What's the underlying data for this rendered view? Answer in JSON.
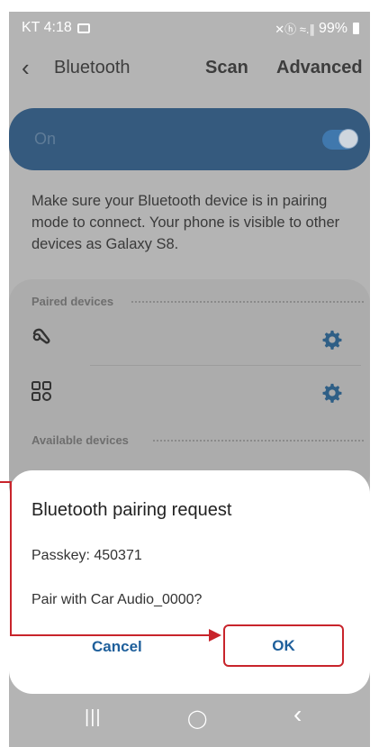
{
  "status_bar": {
    "carrier_time": "KT 4:18",
    "signal_glyphs": "✕ⓗ ≈.∥",
    "battery_percent": "99%"
  },
  "topbar": {
    "title": "Bluetooth",
    "scan_label": "Scan",
    "advanced_label": "Advanced"
  },
  "toggle": {
    "label": "On",
    "state": "on"
  },
  "description": "Make sure your Bluetooth device is in pairing mode to connect. Your phone is visible to other devices as Galaxy S8.",
  "paired_devices": {
    "header": "Paired devices",
    "items": [
      {
        "icon": "headset-icon",
        "glyph": "⌒"
      },
      {
        "icon": "device-grid-icon",
        "glyph": "⊞"
      }
    ]
  },
  "available_devices": {
    "header": "Available devices"
  },
  "dialog": {
    "title": "Bluetooth pairing request",
    "passkey": "Passkey: 450371",
    "question": "Pair with Car Audio_0000?",
    "cancel_label": "Cancel",
    "ok_label": "OK"
  },
  "nav": {
    "recents": "|||",
    "home": "◯",
    "back": "‹"
  },
  "colors": {
    "accent_blue": "#1e5f9b",
    "annotation_red": "#c8242b",
    "toggle_card": "#355a7e"
  }
}
